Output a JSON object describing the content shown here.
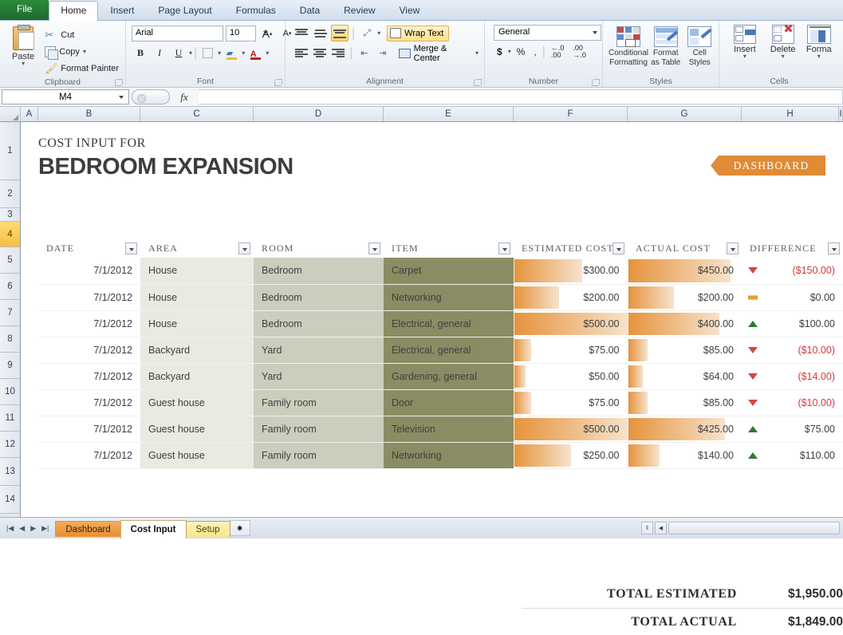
{
  "ribbon": {
    "tabs": [
      {
        "label": "File",
        "name": "tab-file"
      },
      {
        "label": "Home",
        "name": "tab-home"
      },
      {
        "label": "Insert",
        "name": "tab-insert"
      },
      {
        "label": "Page Layout",
        "name": "tab-page-layout"
      },
      {
        "label": "Formulas",
        "name": "tab-formulas"
      },
      {
        "label": "Data",
        "name": "tab-data"
      },
      {
        "label": "Review",
        "name": "tab-review"
      },
      {
        "label": "View",
        "name": "tab-view"
      }
    ],
    "clipboard": {
      "group_label": "Clipboard",
      "paste": "Paste",
      "cut": "Cut",
      "copy": "Copy",
      "format_painter": "Format Painter"
    },
    "font": {
      "group_label": "Font",
      "font_name": "Arial",
      "font_size": "10",
      "bold": "B",
      "italic": "I",
      "underline": "U",
      "grow": "A",
      "shrink": "A"
    },
    "alignment": {
      "group_label": "Alignment",
      "wrap_text": "Wrap Text",
      "merge_center": "Merge & Center"
    },
    "number": {
      "group_label": "Number",
      "format": "General",
      "currency": "$",
      "percent": "%",
      "comma": ",",
      "increase_decimal": ".00",
      "decrease_decimal": ".00"
    },
    "styles": {
      "group_label": "Styles",
      "conditional_formatting": "Conditional\nFormatting",
      "conditional_formatting_l1": "Conditional",
      "conditional_formatting_l2": "Formatting",
      "format_as_table_l1": "Format",
      "format_as_table_l2": "as Table",
      "cell_styles_l1": "Cell",
      "cell_styles_l2": "Styles"
    },
    "cells": {
      "group_label": "Cells",
      "insert": "Insert",
      "delete": "Delete",
      "format": "Forma"
    }
  },
  "formula_bar": {
    "name_box": "M4",
    "fx_label": "fx",
    "formula_value": ""
  },
  "grid": {
    "columns": [
      "A",
      "B",
      "C",
      "D",
      "E",
      "F",
      "G",
      "H",
      "I"
    ],
    "rows": [
      "1",
      "2",
      "3",
      "4",
      "5",
      "6",
      "7",
      "8",
      "9",
      "10",
      "11",
      "12",
      "13",
      "14"
    ],
    "selected_row": "4"
  },
  "sheet": {
    "title_sub": "COST INPUT FOR",
    "title_main": "BEDROOM EXPANSION",
    "dashboard_button": "DASHBOARD",
    "headers": {
      "date": "DATE",
      "area": "AREA",
      "room": "ROOM",
      "item": "ITEM",
      "estimated": "ESTIMATED COST",
      "actual": "ACTUAL COST",
      "difference": "DIFFERENCE"
    },
    "rows": [
      {
        "date": "7/1/2012",
        "area": "House",
        "room": "Bedroom",
        "item": "Carpet",
        "estimated": "$300.00",
        "actual": "$450.00",
        "difference": "($150.00)",
        "est_pct": 60,
        "act_pct": 90,
        "trend": "down",
        "negative": true
      },
      {
        "date": "7/1/2012",
        "area": "House",
        "room": "Bedroom",
        "item": "Networking",
        "estimated": "$200.00",
        "actual": "$200.00",
        "difference": "$0.00",
        "est_pct": 40,
        "act_pct": 40,
        "trend": "flat",
        "negative": false
      },
      {
        "date": "7/1/2012",
        "area": "House",
        "room": "Bedroom",
        "item": "Electrical, general",
        "estimated": "$500.00",
        "actual": "$400.00",
        "difference": "$100.00",
        "est_pct": 100,
        "act_pct": 80,
        "trend": "up",
        "negative": false
      },
      {
        "date": "7/1/2012",
        "area": "Backyard",
        "room": "Yard",
        "item": "Electrical, general",
        "estimated": "$75.00",
        "actual": "$85.00",
        "difference": "($10.00)",
        "est_pct": 15,
        "act_pct": 17,
        "trend": "down",
        "negative": true
      },
      {
        "date": "7/1/2012",
        "area": "Backyard",
        "room": "Yard",
        "item": "Gardening, general",
        "estimated": "$50.00",
        "actual": "$64.00",
        "difference": "($14.00)",
        "est_pct": 10,
        "act_pct": 13,
        "trend": "down",
        "negative": true
      },
      {
        "date": "7/1/2012",
        "area": "Guest house",
        "room": "Family room",
        "item": "Door",
        "estimated": "$75.00",
        "actual": "$85.00",
        "difference": "($10.00)",
        "est_pct": 15,
        "act_pct": 17,
        "trend": "down",
        "negative": true
      },
      {
        "date": "7/1/2012",
        "area": "Guest house",
        "room": "Family room",
        "item": "Television",
        "estimated": "$500.00",
        "actual": "$425.00",
        "difference": "$75.00",
        "est_pct": 100,
        "act_pct": 85,
        "trend": "up",
        "negative": false
      },
      {
        "date": "7/1/2012",
        "area": "Guest house",
        "room": "Family room",
        "item": "Networking",
        "estimated": "$250.00",
        "actual": "$140.00",
        "difference": "$110.00",
        "est_pct": 50,
        "act_pct": 28,
        "trend": "up",
        "negative": false
      }
    ],
    "totals": [
      {
        "label": "TOTAL ESTIMATED",
        "value": "$1,950.00"
      },
      {
        "label": "TOTAL ACTUAL",
        "value": "$1,849.00"
      }
    ]
  },
  "sheet_tabs": {
    "first": "|◀",
    "prev": "◀",
    "next": "▶",
    "last": "▶|",
    "tabs": [
      {
        "label": "Dashboard",
        "state": "dashboard"
      },
      {
        "label": "Cost Input",
        "state": "active"
      },
      {
        "label": "Setup",
        "state": "setup"
      }
    ],
    "new_sheet": "✷"
  },
  "colors": {
    "accent_orange": "#e08b36",
    "item_olive": "#8c8c64",
    "room_beige": "#cdcdbd",
    "area_cream": "#eaeae2",
    "negative_red": "#d03a3a",
    "positive_green": "#2f7a32",
    "flat_yellow": "#e0a92c"
  }
}
